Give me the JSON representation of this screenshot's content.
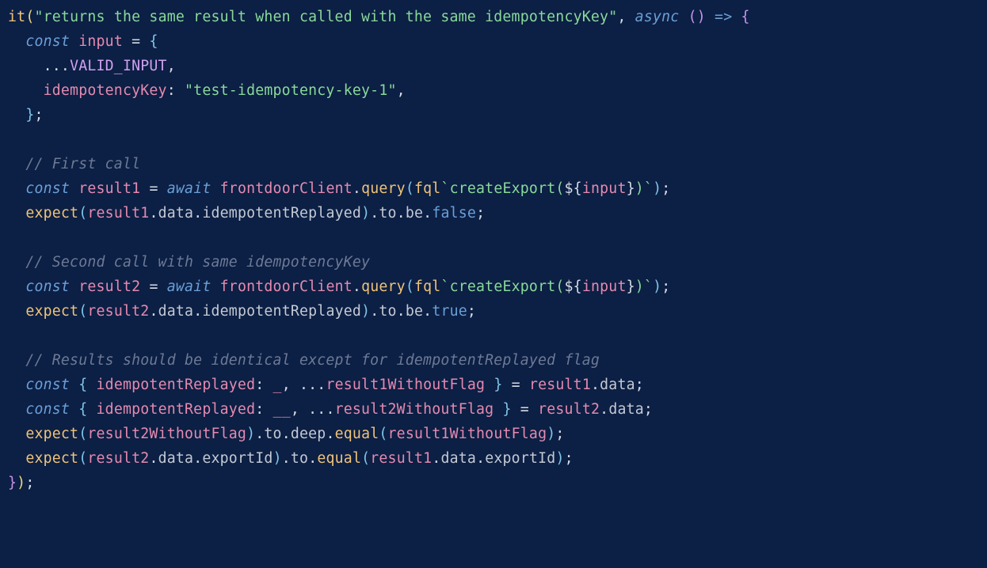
{
  "code": {
    "line1": {
      "fn": "it",
      "str": "\"returns the same result when called with the same idempotencyKey\"",
      "async": "async",
      "arrow": "=>"
    },
    "line2": {
      "kw": "const",
      "var": "input",
      "op": "="
    },
    "line3": {
      "spread": "...",
      "const": "VALID_INPUT"
    },
    "line4": {
      "prop": "idempotencyKey",
      "colon": ":",
      "str": "\"test-idempotency-key-1\""
    },
    "line5": {
      "close": "};"
    },
    "line7": {
      "comment": "// First call"
    },
    "line8": {
      "kw": "const",
      "var": "result1",
      "op": "=",
      "await": "await",
      "obj": "frontdoorClient",
      "method": "query",
      "tag": "fql",
      "tmpl_open": "`createExport(",
      "interp_open": "${",
      "interp_var": "input",
      "interp_close": "}",
      "tmpl_close": ")`"
    },
    "line9": {
      "fn": "expect",
      "arg": "result1",
      "p1": "data",
      "p2": "idempotentReplayed",
      "to": "to",
      "be": "be",
      "val": "false"
    },
    "line11": {
      "comment": "// Second call with same idempotencyKey"
    },
    "line12": {
      "kw": "const",
      "var": "result2",
      "op": "=",
      "await": "await",
      "obj": "frontdoorClient",
      "method": "query",
      "tag": "fql",
      "tmpl_open": "`createExport(",
      "interp_open": "${",
      "interp_var": "input",
      "interp_close": "}",
      "tmpl_close": ")`"
    },
    "line13": {
      "fn": "expect",
      "arg": "result2",
      "p1": "data",
      "p2": "idempotentReplayed",
      "to": "to",
      "be": "be",
      "val": "true"
    },
    "line15": {
      "comment": "// Results should be identical except for idempotentReplayed flag"
    },
    "line16": {
      "kw": "const",
      "prop": "idempotentReplayed",
      "u": "_",
      "rest": "result1WithoutFlag",
      "src": "result1",
      "srcp": "data"
    },
    "line17": {
      "kw": "const",
      "prop": "idempotentReplayed",
      "u": "__",
      "rest": "result2WithoutFlag",
      "src": "result2",
      "srcp": "data"
    },
    "line18": {
      "fn": "expect",
      "arg": "result2WithoutFlag",
      "to": "to",
      "deep": "deep",
      "equal": "equal",
      "arg2": "result1WithoutFlag"
    },
    "line19": {
      "fn": "expect",
      "arg": "result2",
      "p1": "data",
      "p2": "exportId",
      "to": "to",
      "equal": "equal",
      "arg2": "result1",
      "p3": "data",
      "p4": "exportId"
    },
    "line20": {
      "close": "});"
    }
  }
}
